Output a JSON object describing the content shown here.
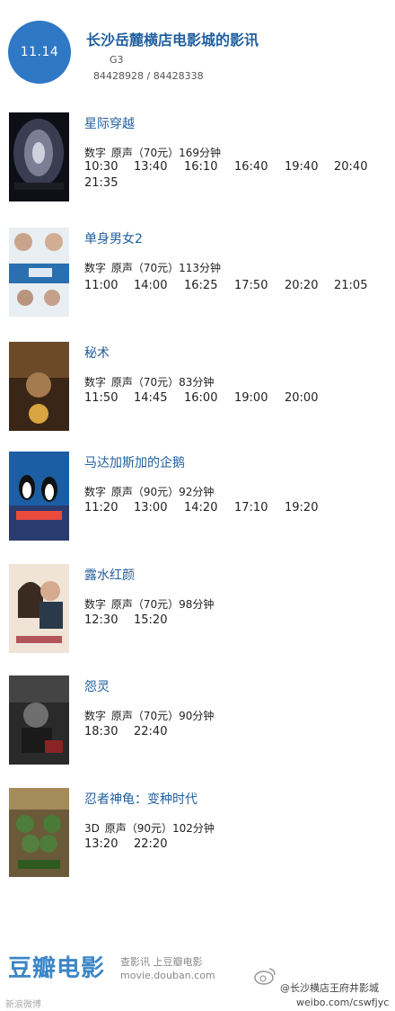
{
  "header": {
    "date": "11.14",
    "cinema_name": "长沙岳麓横店电影城的影讯",
    "hall": "G3",
    "phone": "84428928 / 84428338"
  },
  "movies": [
    {
      "title": "星际穿越",
      "info": "数字 原声（70元）169分钟",
      "times": [
        "10:30",
        "13:40",
        "16:10",
        "16:40",
        "19:40",
        "20:40",
        "21:35"
      ]
    },
    {
      "title": "单身男女2",
      "info": "数字 原声（70元）113分钟",
      "times": [
        "11:00",
        "14:00",
        "16:25",
        "17:50",
        "20:20",
        "21:05"
      ]
    },
    {
      "title": "秘术",
      "info": "数字 原声（70元）83分钟",
      "times": [
        "11:50",
        "14:45",
        "16:00",
        "19:00",
        "20:00"
      ]
    },
    {
      "title": "马达加斯加的企鹅",
      "info": "数字 原声（90元）92分钟",
      "times": [
        "11:20",
        "13:00",
        "14:20",
        "17:10",
        "19:20"
      ]
    },
    {
      "title": "露水红颜",
      "info": "数字 原声（70元）98分钟",
      "times": [
        "12:30",
        "15:20"
      ]
    },
    {
      "title": "怨灵",
      "info": "数字 原声（70元）90分钟",
      "times": [
        "18:30",
        "22:40"
      ]
    },
    {
      "title": "忍者神龟：变种时代",
      "info": "3D 原声（90元）102分钟",
      "times": [
        "13:20",
        "22:20"
      ]
    }
  ],
  "footer": {
    "logo": "豆瓣电影",
    "slogan": "查影讯 上豆瓣电影",
    "url": "movie.douban.com",
    "watermark_handle": "@长沙横店王府井影城",
    "watermark_url": "weibo.com/cswfjyc",
    "watermark_corner": "新浪微博"
  },
  "colors": {
    "accent": "#2f78c5",
    "title_blue": "#1f5f9e",
    "logo_blue": "#3b86c7"
  }
}
